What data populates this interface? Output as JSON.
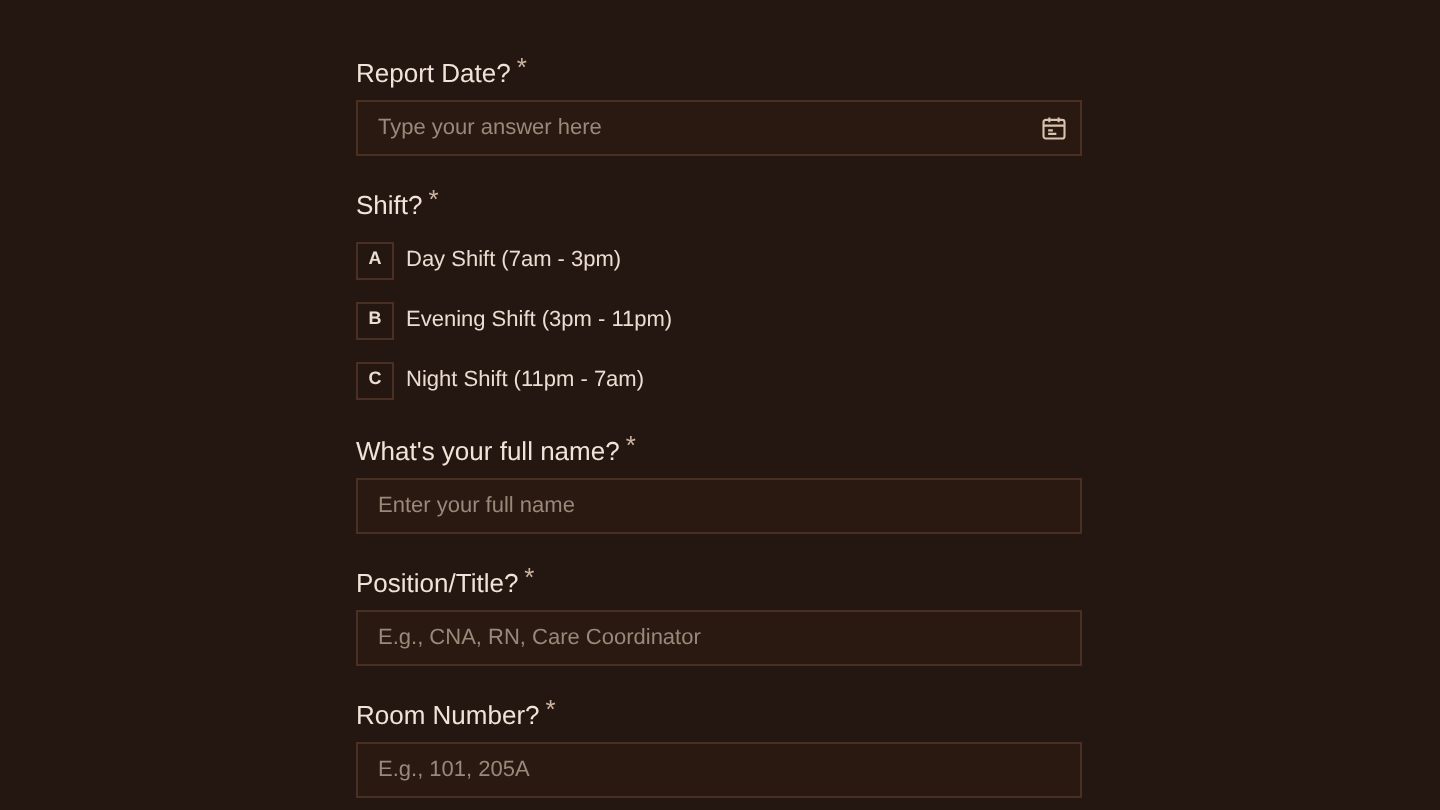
{
  "questions": [
    {
      "kind": "date",
      "label": "Report Date?",
      "asterisk": "*",
      "placeholder": "Type your answer here"
    },
    {
      "kind": "choice",
      "label": "Shift?",
      "asterisk": "*",
      "options": [
        {
          "key": "A",
          "label": "Day Shift (7am - 3pm)",
          "selected": false
        },
        {
          "key": "B",
          "label": "Evening Shift (3pm - 11pm)",
          "selected": false
        },
        {
          "key": "C",
          "label": "Night Shift (11pm - 7am)",
          "selected": false
        }
      ]
    },
    {
      "kind": "text",
      "label": "What's your full name?",
      "asterisk": "*",
      "placeholder": "Enter your full name"
    },
    {
      "kind": "text",
      "label": "Position/Title?",
      "asterisk": "*",
      "placeholder": "E.g., CNA, RN, Care Coordinator"
    },
    {
      "kind": "text",
      "label": "Room Number?",
      "asterisk": "*",
      "placeholder": "E.g., 101, 205A"
    }
  ]
}
